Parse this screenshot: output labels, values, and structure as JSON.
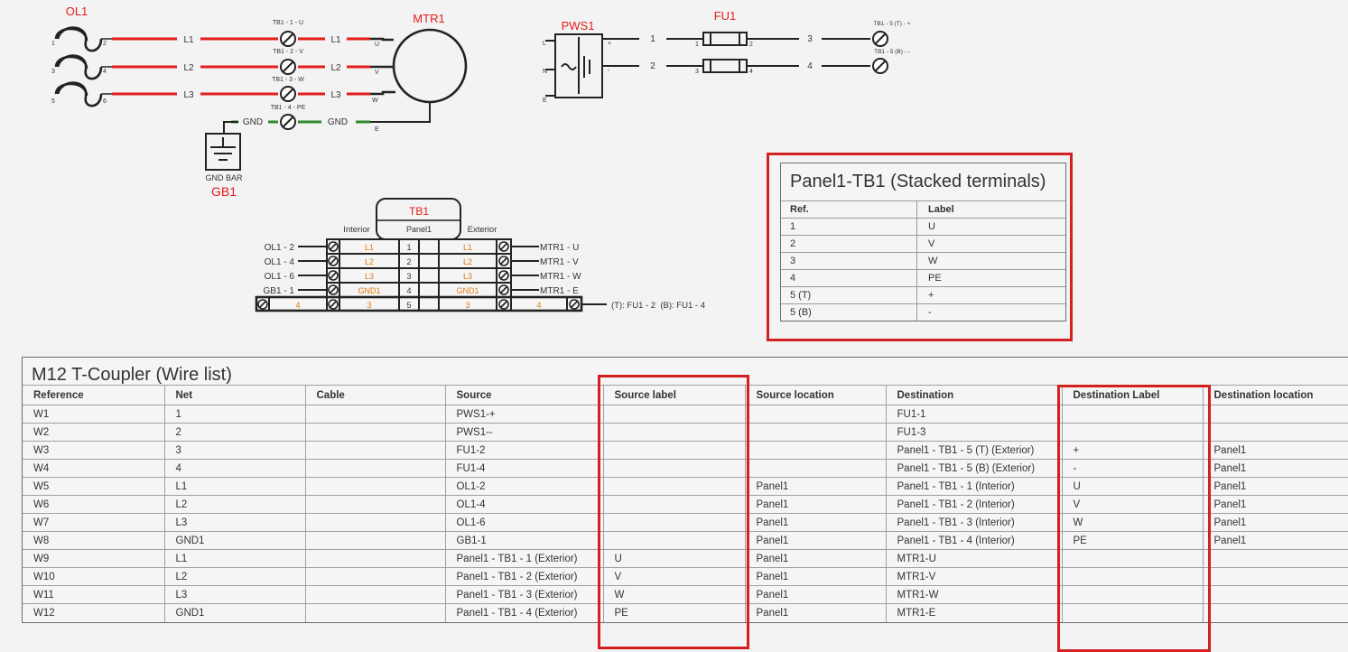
{
  "schematic": {
    "ol1": {
      "name": "OL1",
      "pins": [
        "1",
        "2",
        "3",
        "4",
        "5",
        "6"
      ]
    },
    "mtr1": {
      "name": "MTR1",
      "pins": [
        "U",
        "V",
        "W",
        "E"
      ]
    },
    "pws1": {
      "name": "PWS1",
      "pins_left": [
        "L",
        "N",
        "E"
      ],
      "pins_right": [
        "+",
        "-"
      ]
    },
    "fu1": {
      "name": "FU1",
      "pins": [
        "1",
        "2",
        "3",
        "4"
      ]
    },
    "gb1": {
      "name": "GB1",
      "caption": "GND BAR"
    },
    "nets": {
      "l1": "L1",
      "l2": "L2",
      "l3": "L3",
      "gnd": "GND",
      "n1": "1",
      "n2": "2",
      "n3": "3",
      "n4": "4"
    },
    "terminal_tags": {
      "t1": "TB1 - 1 - U",
      "t2": "TB1 - 2 - V",
      "t3": "TB1 - 3 - W",
      "t4": "TB1 - 4 - PE",
      "t5t": "TB1 - 5 (T) - +",
      "t5b": "TB1 - 5 (B) - -"
    }
  },
  "tb_block": {
    "name": "TB1",
    "panel": "Panel1",
    "interior": "Interior",
    "exterior": "Exterior",
    "rows": [
      {
        "left": "OL1 - 2",
        "int_label": "L1",
        "num": "1",
        "ext_label": "L1",
        "right": "MTR1 - U"
      },
      {
        "left": "OL1 - 4",
        "int_label": "L2",
        "num": "2",
        "ext_label": "L2",
        "right": "MTR1 - V"
      },
      {
        "left": "OL1 - 6",
        "int_label": "L3",
        "num": "3",
        "ext_label": "L3",
        "right": "MTR1 - W"
      },
      {
        "left": "GB1 - 1",
        "int_label": "GND1",
        "num": "4",
        "ext_label": "GND1",
        "right": "MTR1 - E"
      }
    ],
    "stacked": {
      "a": "4",
      "b": "3",
      "num": "5",
      "c": "3",
      "d": "4",
      "note": "(T): FU1 - 2  (B): FU1 - 4"
    }
  },
  "terminal_table": {
    "title": "Panel1-TB1 (Stacked terminals)",
    "columns": [
      "Ref.",
      "Label"
    ],
    "rows": [
      [
        "1",
        "U"
      ],
      [
        "2",
        "V"
      ],
      [
        "3",
        "W"
      ],
      [
        "4",
        "PE"
      ],
      [
        "5 (T)",
        "+"
      ],
      [
        "5 (B)",
        "-"
      ]
    ]
  },
  "wire_list": {
    "title": "M12 T-Coupler (Wire list)",
    "columns": [
      "Reference",
      "Net",
      "Cable",
      "Source",
      "Source label",
      "Source location",
      "Destination",
      "Destination Label",
      "Destination location"
    ],
    "rows": [
      [
        "W1",
        "1",
        "",
        "PWS1-+",
        "",
        "",
        "FU1-1",
        "",
        ""
      ],
      [
        "W2",
        "2",
        "",
        "PWS1--",
        "",
        "",
        "FU1-3",
        "",
        ""
      ],
      [
        "W3",
        "3",
        "",
        "FU1-2",
        "",
        "",
        "Panel1 - TB1 - 5 (T) (Exterior)",
        "+",
        "Panel1"
      ],
      [
        "W4",
        "4",
        "",
        "FU1-4",
        "",
        "",
        "Panel1 - TB1 - 5 (B) (Exterior)",
        "-",
        "Panel1"
      ],
      [
        "W5",
        "L1",
        "",
        "OL1-2",
        "",
        "Panel1",
        "Panel1 - TB1 - 1 (Interior)",
        "U",
        "Panel1"
      ],
      [
        "W6",
        "L2",
        "",
        "OL1-4",
        "",
        "Panel1",
        "Panel1 - TB1 - 2 (Interior)",
        "V",
        "Panel1"
      ],
      [
        "W7",
        "L3",
        "",
        "OL1-6",
        "",
        "Panel1",
        "Panel1 - TB1 - 3 (Interior)",
        "W",
        "Panel1"
      ],
      [
        "W8",
        "GND1",
        "",
        "GB1-1",
        "",
        "Panel1",
        "Panel1 - TB1 - 4 (Interior)",
        "PE",
        "Panel1"
      ],
      [
        "W9",
        "L1",
        "",
        "Panel1 - TB1 - 1 (Exterior)",
        "U",
        "Panel1",
        "MTR1-U",
        "",
        ""
      ],
      [
        "W10",
        "L2",
        "",
        "Panel1 - TB1 - 2 (Exterior)",
        "V",
        "Panel1",
        "MTR1-V",
        "",
        ""
      ],
      [
        "W11",
        "L3",
        "",
        "Panel1 - TB1 - 3 (Exterior)",
        "W",
        "Panel1",
        "MTR1-W",
        "",
        ""
      ],
      [
        "W12",
        "GND1",
        "",
        "Panel1 - TB1 - 4 (Exterior)",
        "PE",
        "Panel1",
        "MTR1-E",
        "",
        ""
      ]
    ]
  },
  "colors": {
    "wire_red": "#e31c1c",
    "wire_green": "#2f8a2f",
    "label_red": "#e31c1c",
    "label_orange": "#e07a10",
    "highlight": "#d42020"
  }
}
